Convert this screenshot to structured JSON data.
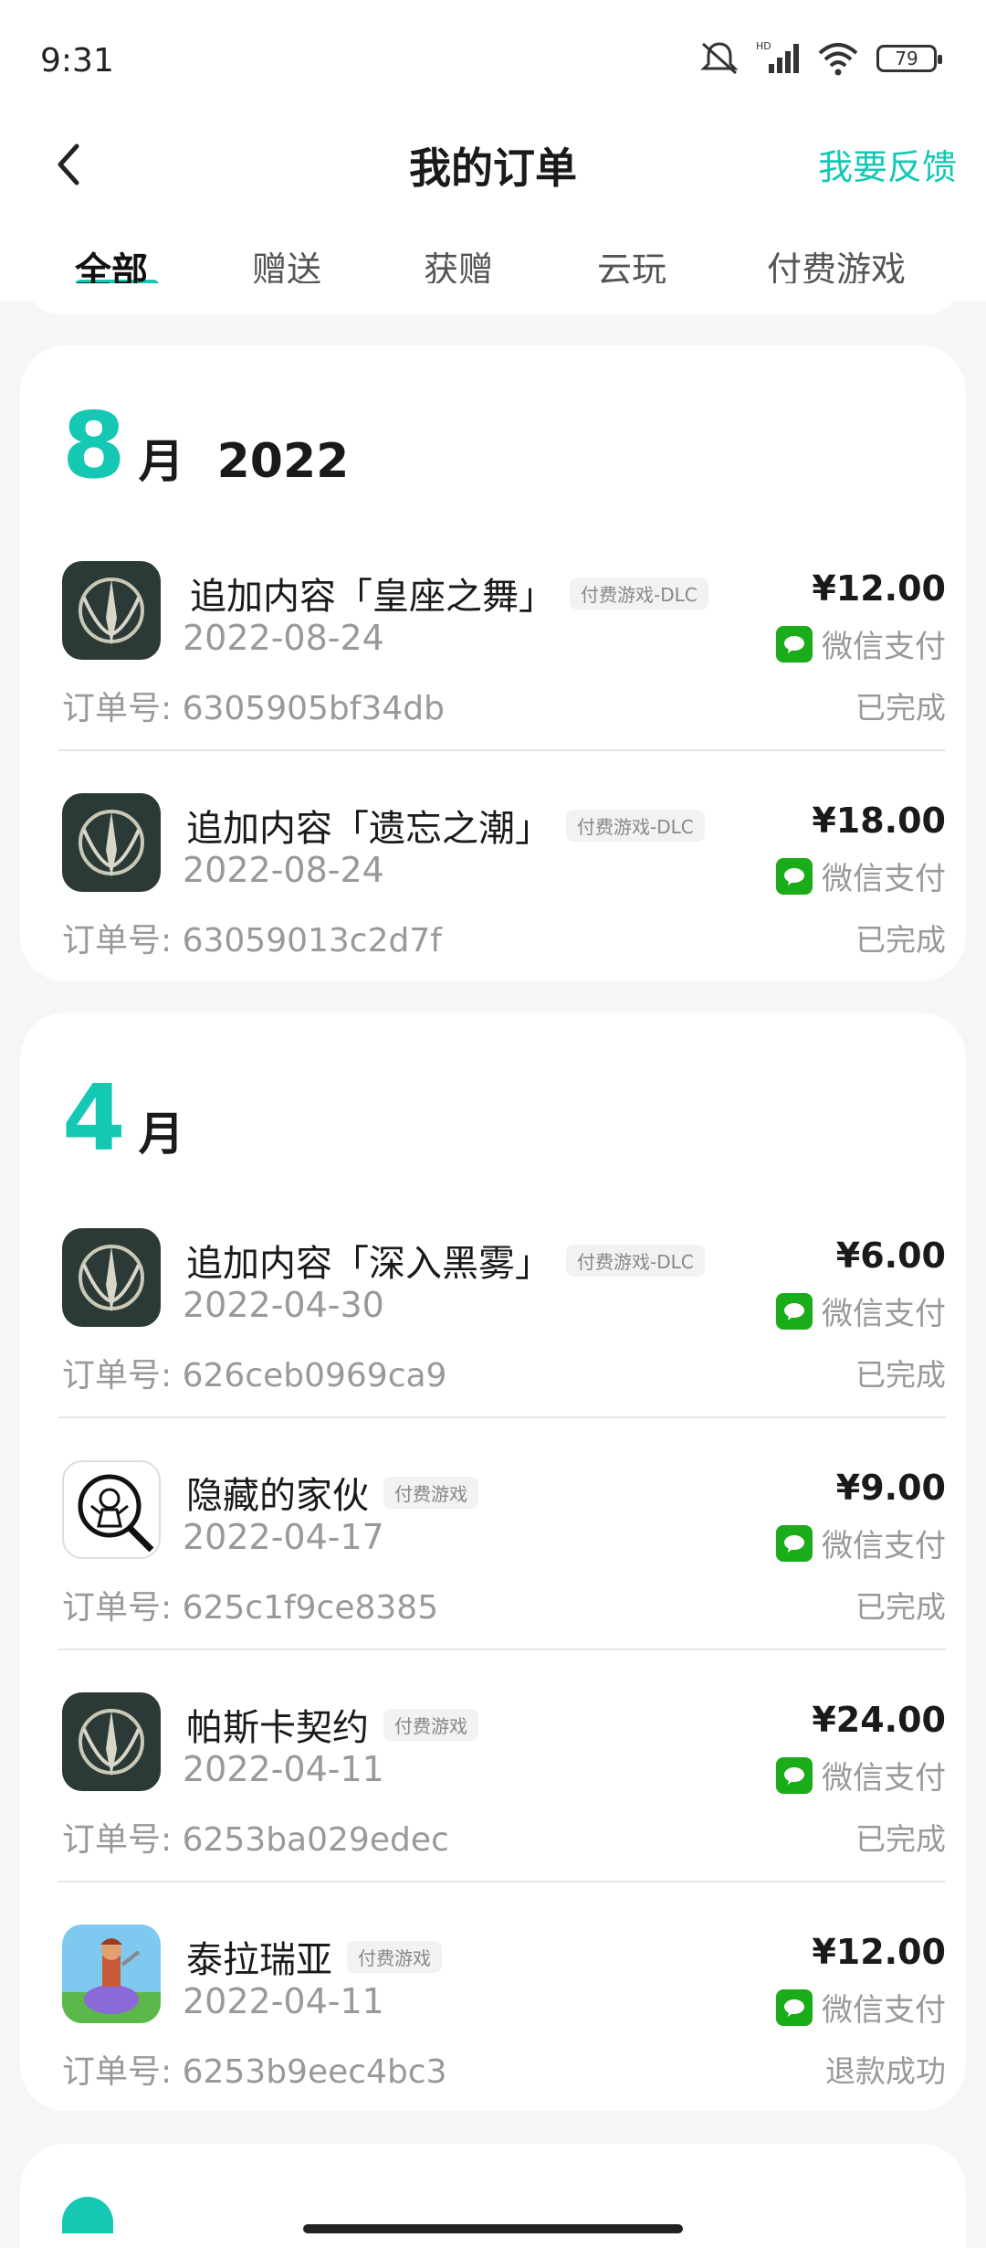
{
  "status_bar": {
    "time": "9:31",
    "battery": "79"
  },
  "header": {
    "title": "我的订单",
    "feedback": "我要反馈"
  },
  "tabs": [
    "全部",
    "赠送",
    "获赠",
    "云玩",
    "付费游戏"
  ],
  "groups": [
    {
      "month": "8",
      "month_label": "月",
      "year": "2022",
      "orders": [
        {
          "name": "追加内容「皇座之舞」",
          "tag": "付费游戏-DLC",
          "date": "2022-08-24",
          "price": "¥12.00",
          "payment": "微信支付",
          "order_label": "订单号: 6305905bf34db",
          "status": "已完成",
          "icon": "game-emblem-icon"
        },
        {
          "name": "追加内容「遗忘之潮」",
          "tag": "付费游戏-DLC",
          "date": "2022-08-24",
          "price": "¥18.00",
          "payment": "微信支付",
          "order_label": "订单号: 63059013c2d7f",
          "status": "已完成",
          "icon": "game-emblem-icon"
        }
      ]
    },
    {
      "month": "4",
      "month_label": "月",
      "year": "",
      "orders": [
        {
          "name": "追加内容「深入黑雾」",
          "tag": "付费游戏-DLC",
          "date": "2022-04-30",
          "price": "¥6.00",
          "payment": "微信支付",
          "order_label": "订单号: 626ceb0969ca9",
          "status": "已完成",
          "icon": "game-emblem-icon"
        },
        {
          "name": "隐藏的家伙",
          "tag": "付费游戏",
          "date": "2022-04-17",
          "price": "¥9.00",
          "payment": "微信支付",
          "order_label": "订单号: 625c1f9ce8385",
          "status": "已完成",
          "icon": "hidden-folks-icon"
        },
        {
          "name": "帕斯卡契约",
          "tag": "付费游戏",
          "date": "2022-04-11",
          "price": "¥24.00",
          "payment": "微信支付",
          "order_label": "订单号: 6253ba029edec",
          "status": "已完成",
          "icon": "game-emblem-icon"
        },
        {
          "name": "泰拉瑞亚",
          "tag": "付费游戏",
          "date": "2022-04-11",
          "price": "¥12.00",
          "payment": "微信支付",
          "order_label": "订单号: 6253b9eec4bc3",
          "status": "退款成功",
          "icon": "terraria-icon"
        }
      ]
    }
  ],
  "colors": {
    "accent": "#14c8b4",
    "wechat": "#1aad19",
    "background": "#f4f6f8"
  }
}
